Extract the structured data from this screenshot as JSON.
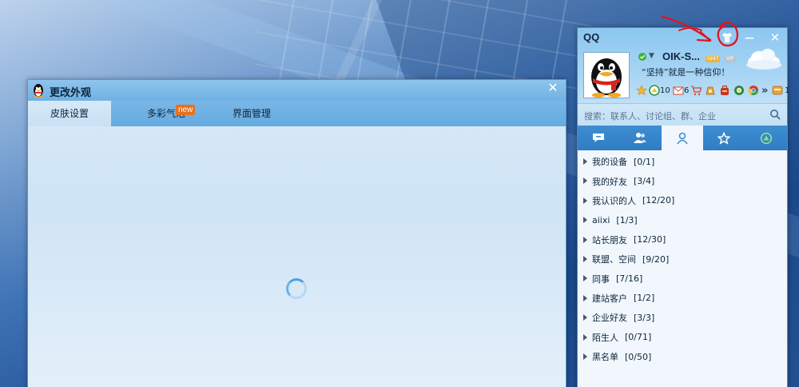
{
  "skin_window": {
    "title": "更改外观",
    "close_glyph": "✕",
    "tabs": [
      {
        "label": "皮肤设置",
        "active": true
      },
      {
        "label": "多彩气泡",
        "active": false,
        "badge": "new"
      },
      {
        "label": "界面管理",
        "active": false
      }
    ]
  },
  "qq": {
    "title": "QQ",
    "min_glyph": "—",
    "close_glyph": "✕",
    "nickname": "OIK-S...",
    "lv_badge": "LV47",
    "vip_badge": "VIP",
    "signature": "“坚持”就是一种信仰！",
    "icon_counts": {
      "zone": "10",
      "mail": "6",
      "extra": "1"
    },
    "search_placeholder": "搜索：联系人、讨论组、群、企业",
    "groups": [
      {
        "name": "我的设备",
        "count": "[0/1]"
      },
      {
        "name": "我的好友",
        "count": "[3/4]"
      },
      {
        "name": "我认识的人",
        "count": "[12/20]"
      },
      {
        "name": "aiixi",
        "count": "[1/3]"
      },
      {
        "name": "站长朋友",
        "count": "[12/30]"
      },
      {
        "name": "联盟、空间",
        "count": "[9/20]"
      },
      {
        "name": "同事",
        "count": "[7/16]"
      },
      {
        "name": "建站客户",
        "count": "[1/2]"
      },
      {
        "name": "企业好友",
        "count": "[3/3]"
      },
      {
        "name": "陌生人",
        "count": "[0/71]"
      },
      {
        "name": "黑名单",
        "count": "[0/50]"
      }
    ]
  },
  "colors": {
    "accent_blue": "#3e8ed2",
    "annotation_red": "#e0141e",
    "new_badge": "#e8711e"
  }
}
